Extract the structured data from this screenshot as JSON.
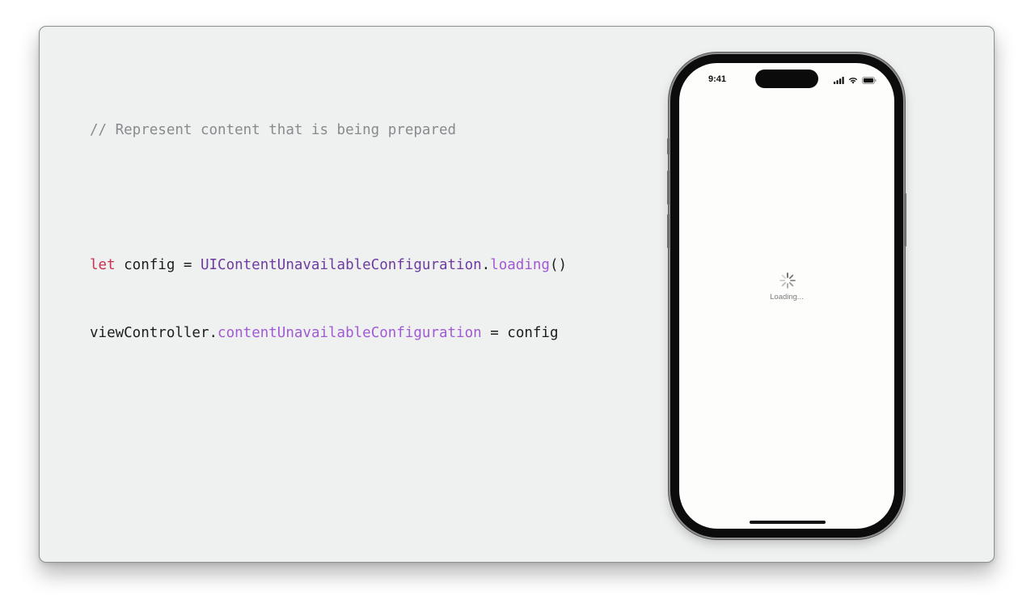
{
  "code": {
    "comment": "// Represent content that is being prepared",
    "line1": {
      "keyword": "let",
      "variable": " config = ",
      "type": "UIContentUnavailableConfiguration",
      "dot": ".",
      "method": "loading",
      "call": "()"
    },
    "line2": {
      "receiver": "viewController.",
      "property": "contentUnavailableConfiguration",
      "assignment": " = config"
    }
  },
  "phone": {
    "status_time": "9:41",
    "status_icons": [
      "cellular-signal-icon",
      "wifi-icon",
      "battery-icon"
    ],
    "spinner_icon": "activity-spinner-icon",
    "loading_label": "Loading..."
  },
  "colors": {
    "slide_background": "#eff0f0",
    "comment": "#8a8a8e",
    "keyword": "#c9314f",
    "type": "#6e3ba1",
    "member": "#a05ad3",
    "plain": "#1d1d1f"
  }
}
